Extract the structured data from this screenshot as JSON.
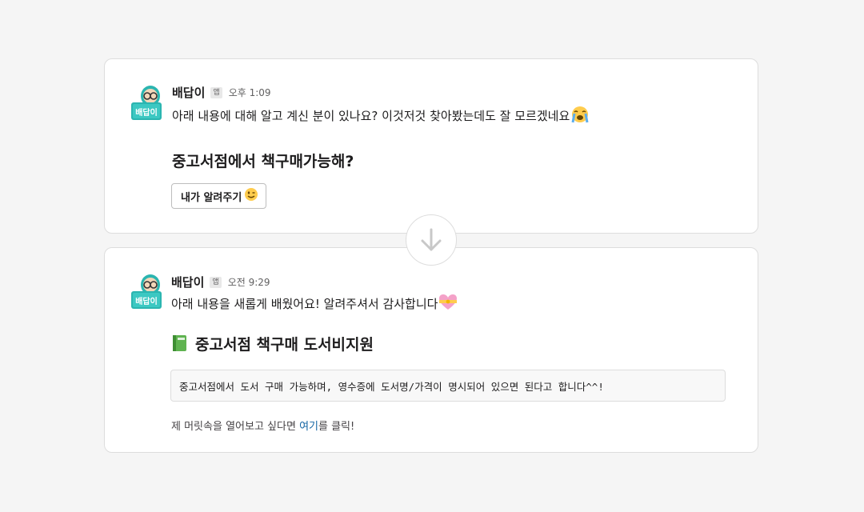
{
  "colors": {
    "page_background": "#f5f5f5",
    "card_background": "#ffffff",
    "card_border": "#dddddd",
    "link": "#1264a3",
    "avatar_teal": "#2bb5b0"
  },
  "top_message": {
    "avatar_text": "배답이",
    "sender": "배답이",
    "badge": "앱",
    "time": "오후 1:09",
    "text": "아래 내용에 대해 알고 계신 분이 있나요? 이것저것 찾아봤는데도 잘 모르겠네요",
    "text_emoji": "loudly-crying-face",
    "question": "중고서점에서 책구매가능해?",
    "button_label": "내가 알려주기",
    "button_emoji": "winking-face"
  },
  "transition": {
    "icon": "arrow-down-icon"
  },
  "bottom_message": {
    "avatar_text": "배답이",
    "sender": "배답이",
    "badge": "앱",
    "time": "오전 9:29",
    "text": "아래 내용을 새롭게 배웠어요! 알려주셔서 감사합니다",
    "text_emoji": "heart-with-ribbon",
    "title_emoji": "green-book",
    "title": "중고서점 책구매 도서비지원",
    "answer": "중고서점에서 도서 구매 가능하며, 영수증에 도서명/가격이 명시되어 있으면 된다고 합니다^^!",
    "footer_before": "제 머릿속을 열어보고 싶다면 ",
    "footer_link": "여기",
    "footer_after": "를 클릭!"
  }
}
